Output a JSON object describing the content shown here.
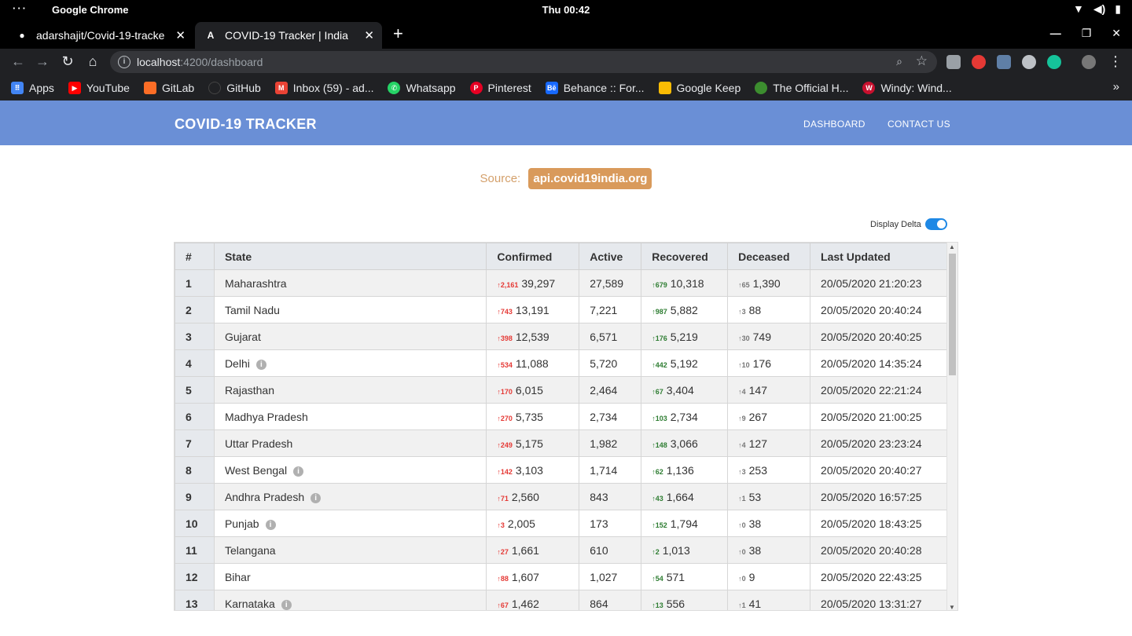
{
  "os": {
    "app_name": "Google Chrome",
    "clock": "Thu 00:42"
  },
  "browser": {
    "tabs": [
      {
        "title": "adarshajit/Covid-19-tracke",
        "icon": "github-icon"
      },
      {
        "title": "COVID-19 Tracker | India",
        "icon": "angular-icon"
      }
    ],
    "url_host": "localhost",
    "url_path": ":4200/dashboard",
    "bookmarks": [
      {
        "label": "Apps",
        "color": "#4285f4"
      },
      {
        "label": "YouTube",
        "color": "#ff0000"
      },
      {
        "label": "GitLab",
        "color": "#fc6d26"
      },
      {
        "label": "GitHub",
        "color": "#202124"
      },
      {
        "label": "Inbox (59) - ad...",
        "color": "#ea4335"
      },
      {
        "label": "Whatsapp",
        "color": "#25d366"
      },
      {
        "label": "Pinterest",
        "color": "#e60023"
      },
      {
        "label": "Behance :: For...",
        "color": "#1769ff"
      },
      {
        "label": "Google Keep",
        "color": "#fbbc04"
      },
      {
        "label": "The Official H...",
        "color": "#3c8d2f"
      },
      {
        "label": "Windy: Wind...",
        "color": "#c8102e"
      }
    ]
  },
  "page": {
    "brand": "COVID-19 TRACKER",
    "nav": {
      "dashboard": "DASHBOARD",
      "contact": "CONTACT US"
    },
    "source_label": "Source:",
    "source_link": "api.covid19india.org",
    "delta_label": "Display Delta",
    "table": {
      "headers": [
        "#",
        "State",
        "Confirmed",
        "Active",
        "Recovered",
        "Deceased",
        "Last Updated"
      ],
      "rows": [
        {
          "n": "1",
          "state": "Maharashtra",
          "info": false,
          "dc": "2,161",
          "c": "39,297",
          "a": "27,589",
          "dr": "679",
          "r": "10,318",
          "dd": "65",
          "d": "1,390",
          "t": "20/05/2020 21:20:23"
        },
        {
          "n": "2",
          "state": "Tamil Nadu",
          "info": false,
          "dc": "743",
          "c": "13,191",
          "a": "7,221",
          "dr": "987",
          "r": "5,882",
          "dd": "3",
          "d": "88",
          "t": "20/05/2020 20:40:24"
        },
        {
          "n": "3",
          "state": "Gujarat",
          "info": false,
          "dc": "398",
          "c": "12,539",
          "a": "6,571",
          "dr": "176",
          "r": "5,219",
          "dd": "30",
          "d": "749",
          "t": "20/05/2020 20:40:25"
        },
        {
          "n": "4",
          "state": "Delhi",
          "info": true,
          "dc": "534",
          "c": "11,088",
          "a": "5,720",
          "dr": "442",
          "r": "5,192",
          "dd": "10",
          "d": "176",
          "t": "20/05/2020 14:35:24"
        },
        {
          "n": "5",
          "state": "Rajasthan",
          "info": false,
          "dc": "170",
          "c": "6,015",
          "a": "2,464",
          "dr": "67",
          "r": "3,404",
          "dd": "4",
          "d": "147",
          "t": "20/05/2020 22:21:24"
        },
        {
          "n": "6",
          "state": "Madhya Pradesh",
          "info": false,
          "dc": "270",
          "c": "5,735",
          "a": "2,734",
          "dr": "103",
          "r": "2,734",
          "dd": "9",
          "d": "267",
          "t": "20/05/2020 21:00:25"
        },
        {
          "n": "7",
          "state": "Uttar Pradesh",
          "info": false,
          "dc": "249",
          "c": "5,175",
          "a": "1,982",
          "dr": "148",
          "r": "3,066",
          "dd": "4",
          "d": "127",
          "t": "20/05/2020 23:23:24"
        },
        {
          "n": "8",
          "state": "West Bengal",
          "info": true,
          "dc": "142",
          "c": "3,103",
          "a": "1,714",
          "dr": "62",
          "r": "1,136",
          "dd": "3",
          "d": "253",
          "t": "20/05/2020 20:40:27"
        },
        {
          "n": "9",
          "state": "Andhra Pradesh",
          "info": true,
          "dc": "71",
          "c": "2,560",
          "a": "843",
          "dr": "43",
          "r": "1,664",
          "dd": "1",
          "d": "53",
          "t": "20/05/2020 16:57:25"
        },
        {
          "n": "10",
          "state": "Punjab",
          "info": true,
          "dc": "3",
          "c": "2,005",
          "a": "173",
          "dr": "152",
          "r": "1,794",
          "dd": "0",
          "d": "38",
          "t": "20/05/2020 18:43:25"
        },
        {
          "n": "11",
          "state": "Telangana",
          "info": false,
          "dc": "27",
          "c": "1,661",
          "a": "610",
          "dr": "2",
          "r": "1,013",
          "dd": "0",
          "d": "38",
          "t": "20/05/2020 20:40:28"
        },
        {
          "n": "12",
          "state": "Bihar",
          "info": false,
          "dc": "88",
          "c": "1,607",
          "a": "1,027",
          "dr": "54",
          "r": "571",
          "dd": "0",
          "d": "9",
          "t": "20/05/2020 22:43:25"
        },
        {
          "n": "13",
          "state": "Karnataka",
          "info": true,
          "dc": "67",
          "c": "1,462",
          "a": "864",
          "dr": "13",
          "r": "556",
          "dd": "1",
          "d": "41",
          "t": "20/05/2020 13:31:27"
        }
      ]
    }
  }
}
